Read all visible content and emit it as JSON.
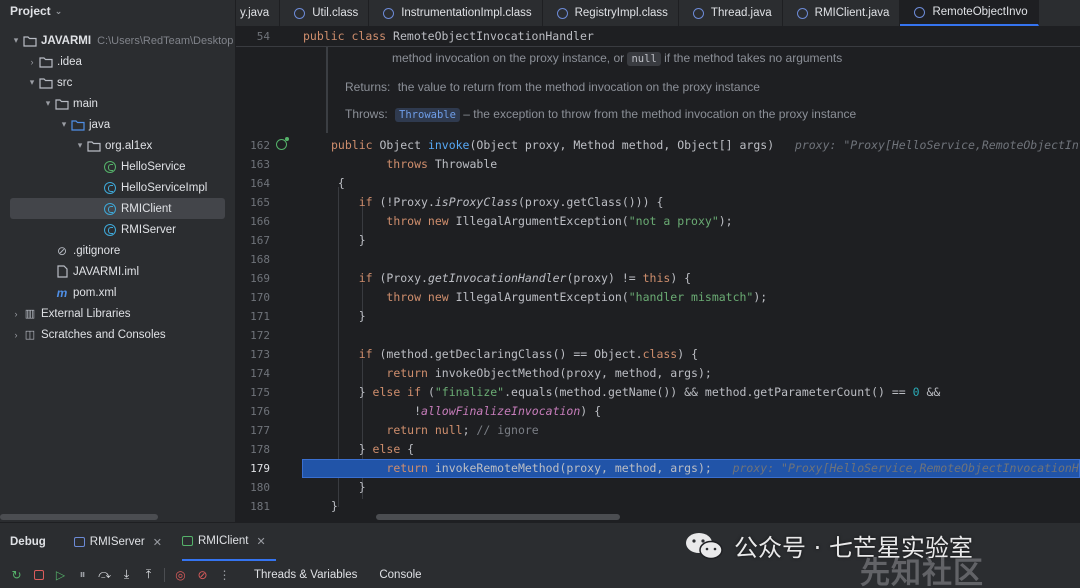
{
  "project": {
    "title": "Project",
    "tree": [
      {
        "level": 0,
        "arrow": "▾",
        "icon": "module-folder-icon",
        "label": "JAVARMI",
        "path": "C:\\Users\\RedTeam\\Desktop"
      },
      {
        "level": 1,
        "arrow": "›",
        "icon": "folder-icon",
        "label": ".idea"
      },
      {
        "level": 1,
        "arrow": "▾",
        "icon": "folder-icon",
        "label": "src"
      },
      {
        "level": 2,
        "arrow": "▾",
        "icon": "folder-icon",
        "label": "main"
      },
      {
        "level": 3,
        "arrow": "▾",
        "icon": "source-folder-icon",
        "label": "java"
      },
      {
        "level": 4,
        "arrow": "▾",
        "icon": "package-icon",
        "label": "org.al1ex"
      },
      {
        "level": 5,
        "arrow": "",
        "icon": "interface-icon",
        "label": "HelloService"
      },
      {
        "level": 5,
        "arrow": "",
        "icon": "class-icon",
        "label": "HelloServiceImpl"
      },
      {
        "level": 5,
        "arrow": "",
        "icon": "class-icon",
        "label": "RMIClient",
        "selected": true
      },
      {
        "level": 5,
        "arrow": "",
        "icon": "class-icon",
        "label": "RMIServer"
      },
      {
        "level": 2,
        "arrow": "",
        "icon": "gitignore-icon",
        "label": ".gitignore"
      },
      {
        "level": 2,
        "arrow": "",
        "icon": "iml-file-icon",
        "label": "JAVARMI.iml"
      },
      {
        "level": 2,
        "arrow": "",
        "icon": "maven-icon",
        "label": "pom.xml"
      },
      {
        "level": 0,
        "arrow": "›",
        "icon": "libraries-icon",
        "label": "External Libraries"
      },
      {
        "level": 0,
        "arrow": "›",
        "icon": "scratches-icon",
        "label": "Scratches and Consoles"
      }
    ]
  },
  "tabs": [
    {
      "label": "y.java",
      "icon": false
    },
    {
      "label": "Util.class",
      "icon": true
    },
    {
      "label": "InstrumentationImpl.class",
      "icon": true
    },
    {
      "label": "RegistryImpl.class",
      "icon": true
    },
    {
      "label": "Thread.java",
      "icon": true
    },
    {
      "label": "RMIClient.java",
      "icon": true
    },
    {
      "label": "RemoteObjectInvo",
      "icon": true,
      "active": true
    }
  ],
  "editor": {
    "sticky": {
      "line": "54",
      "keyword1": "public",
      "keyword2": "class",
      "name": "RemoteObjectInvocationHandler"
    },
    "doc": {
      "param_line_a": "method invocation on the proxy instance, or",
      "param_null": "null",
      "param_line_b": "if the method takes no arguments",
      "returns_key": "Returns:",
      "returns_text": "the value to return from the method invocation on the proxy instance",
      "throws_key": "Throws:",
      "throws_link": "Throwable",
      "throws_text": "– the exception to throw from the method invocation on the proxy instance"
    },
    "line_numbers": [
      "162",
      "163",
      "164",
      "165",
      "166",
      "167",
      "168",
      "169",
      "170",
      "171",
      "172",
      "173",
      "174",
      "175",
      "176",
      "177",
      "178",
      "179",
      "180",
      "181"
    ],
    "hint_162": "proxy: \"Proxy[HelloService,RemoteObjectInv",
    "hint_179": "proxy: \"Proxy[HelloService,RemoteObjectInvocationH",
    "strings": {
      "not_proxy": "\"not a proxy\"",
      "handler_mismatch": "\"handler mismatch\"",
      "finalize": "\"finalize\""
    },
    "comment_ignore": "// ignore",
    "number_zero": "0"
  },
  "debug": {
    "title": "Debug",
    "sessions": [
      {
        "label": "RMIServer",
        "active": false
      },
      {
        "label": "RMIClient",
        "active": true
      }
    ],
    "toolbar_tabs": [
      "Threads & Variables",
      "Console"
    ]
  },
  "watermark": {
    "text": "公众号 · 七芒星实验室",
    "secondary": "先知社区"
  }
}
